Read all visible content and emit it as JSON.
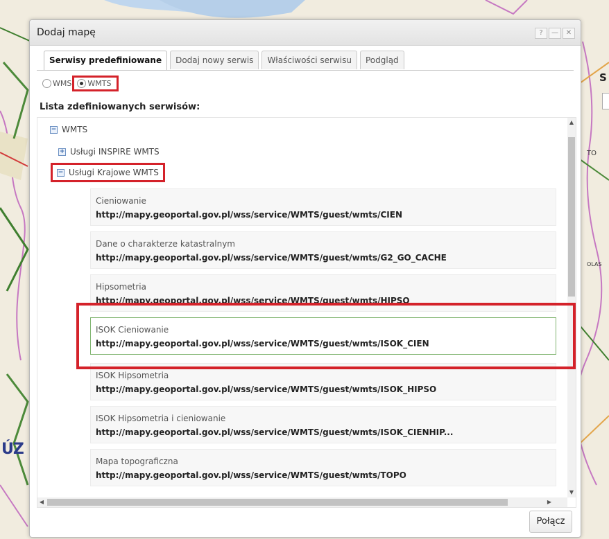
{
  "map": {
    "label_left": "ÚZ",
    "label_right": "S",
    "label_to": "TO",
    "label_olas": "OLAS"
  },
  "dialog": {
    "title": "Dodaj mapę",
    "controls": [
      "?",
      "—",
      "✕"
    ],
    "tabs": [
      {
        "label": "Serwisy predefiniowane",
        "active": true
      },
      {
        "label": "Dodaj nowy serwis",
        "active": false
      },
      {
        "label": "Właściwości serwisu",
        "active": false
      },
      {
        "label": "Podgląd",
        "active": false
      }
    ],
    "radio": {
      "options": [
        {
          "label": "WMS",
          "checked": false
        },
        {
          "label": "WMTS",
          "checked": true
        }
      ]
    },
    "list_heading": "Lista zdefiniowanych serwisów:",
    "tree": {
      "root": {
        "label": "WMTS",
        "expanded": true
      },
      "groups": [
        {
          "label": "Usługi INSPIRE WMTS",
          "expanded": false
        },
        {
          "label": "Usługi Krajowe WMTS",
          "expanded": true
        }
      ]
    },
    "services": [
      {
        "name": "Cieniowanie",
        "url": "http://mapy.geoportal.gov.pl/wss/service/WMTS/guest/wmts/CIEN"
      },
      {
        "name": "Dane o charakterze katastralnym",
        "url": "http://mapy.geoportal.gov.pl/wss/service/WMTS/guest/wmts/G2_GO_CACHE"
      },
      {
        "name": "Hipsometria",
        "url": "http://mapy.geoportal.gov.pl/wss/service/WMTS/guest/wmts/HIPSO"
      },
      {
        "name": "ISOK Cieniowanie",
        "url": "http://mapy.geoportal.gov.pl/wss/service/WMTS/guest/wmts/ISOK_CIEN",
        "selected": true
      },
      {
        "name": "ISOK Hipsometria",
        "url": "http://mapy.geoportal.gov.pl/wss/service/WMTS/guest/wmts/ISOK_HIPSO"
      },
      {
        "name": "ISOK Hipsometria i cieniowanie",
        "url": "http://mapy.geoportal.gov.pl/wss/service/WMTS/guest/wmts/ISOK_CIENHIP..."
      },
      {
        "name": "Mapa topograficzna",
        "url": "http://mapy.geoportal.gov.pl/wss/service/WMTS/guest/wmts/TOPO"
      }
    ],
    "connect_label": "Połącz"
  },
  "colors": {
    "highlight": "#d4222a",
    "selected_border": "#7fb46f"
  }
}
